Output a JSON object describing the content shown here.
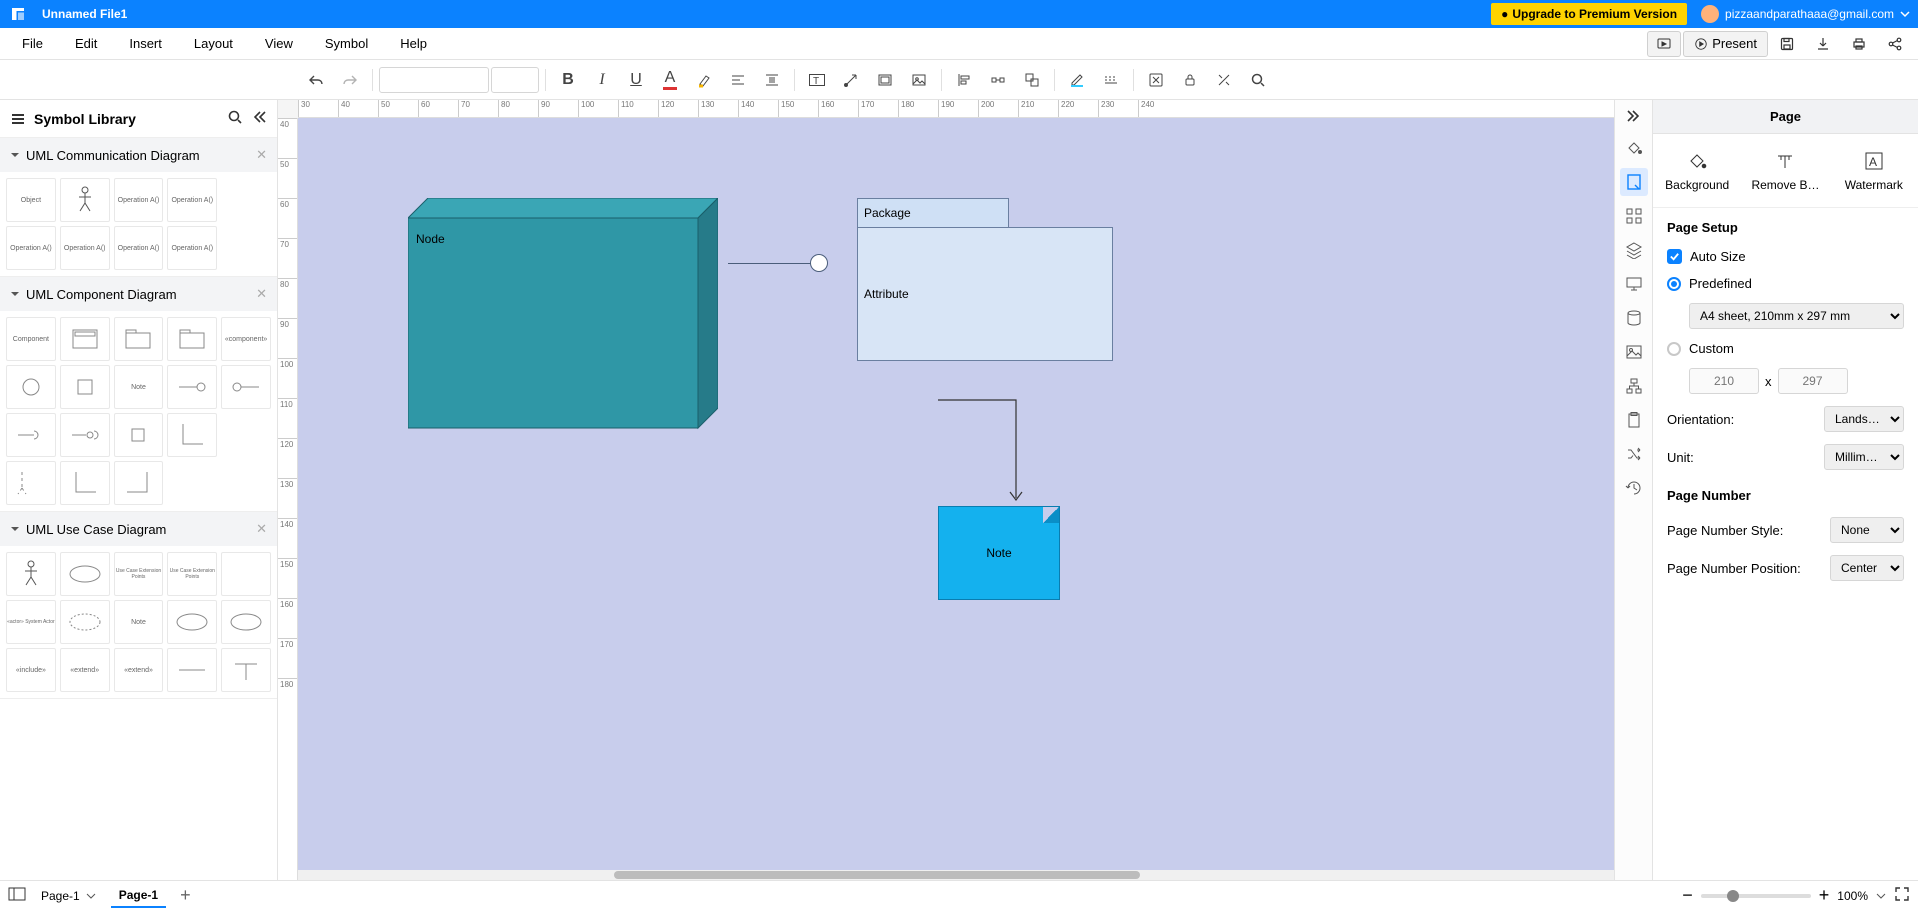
{
  "header": {
    "filename": "Unnamed File1",
    "upgrade": "Upgrade to Premium Version",
    "email": "pizzaandparathaaa@gmail.com"
  },
  "menu": {
    "file": "File",
    "edit": "Edit",
    "insert": "Insert",
    "layout": "Layout",
    "view": "View",
    "symbol": "Symbol",
    "help": "Help",
    "present": "Present"
  },
  "symbol_panel": {
    "title": "Symbol Library",
    "sections": {
      "comm": "UML Communication Diagram",
      "comp": "UML Component Diagram",
      "usecase": "UML Use Case Diagram"
    },
    "items": {
      "object": "Object",
      "actor": "Actor",
      "opA": "Operation A()",
      "opA2": "Operation A()",
      "opA3": "Operation A()",
      "opA4": "Operation A()",
      "opA5": "Operation A()",
      "opA6": "Operation A()",
      "component": "Component",
      "compbox": "",
      "pkg": "",
      "pkg2": "",
      "compstereo": "«component»",
      "circle": "",
      "square": "",
      "note": "Note",
      "lolli1": "",
      "lolli2": "",
      "req1": "",
      "req2": "",
      "sq2": "",
      "angle": "",
      "dash": "",
      "l1": "",
      "l2": "",
      "uc_actor": "Actor",
      "usecase_el": "Use Case",
      "ucx": "Use Case\nExtension Points",
      "ucx2": "Use Case\nExtension Points",
      "blank": "",
      "sysactor": "«actor»\nSystem Actor",
      "collab": "Collaboration X",
      "note2": "Note",
      "o2": "",
      "o3": "",
      "inc": "«include»",
      "ext": "«extend»",
      "ext2": "«extend»",
      "line": "",
      "t": ""
    }
  },
  "canvas": {
    "node_label": "Node",
    "package_label": "Package",
    "attribute_label": "Attribute",
    "note_label": "Note",
    "hruler": [
      "30",
      "40",
      "50",
      "60",
      "70",
      "80",
      "90",
      "100",
      "110",
      "120",
      "130",
      "140",
      "150",
      "160",
      "170",
      "180",
      "190",
      "200",
      "210",
      "220",
      "230",
      "240"
    ],
    "vruler": [
      "40",
      "50",
      "60",
      "70",
      "80",
      "90",
      "100",
      "110",
      "120",
      "130",
      "140",
      "150",
      "160",
      "170",
      "180"
    ]
  },
  "right": {
    "title": "Page",
    "background": "Background",
    "removebg": "Remove B…",
    "watermark": "Watermark",
    "page_setup": "Page Setup",
    "auto_size": "Auto Size",
    "predefined": "Predefined",
    "predefined_value": "A4 sheet, 210mm x 297 mm",
    "custom": "Custom",
    "width": "210",
    "height": "297",
    "times": "x",
    "orientation": "Orientation:",
    "orientation_value": "Lands…",
    "unit": "Unit:",
    "unit_value": "Millim…",
    "page_number": "Page Number",
    "pn_style": "Page Number Style:",
    "pn_style_value": "None",
    "pn_pos": "Page Number Position:",
    "pn_pos_value": "Center"
  },
  "status": {
    "page_sel": "Page-1",
    "page_tab": "Page-1",
    "zoom": "100%"
  }
}
